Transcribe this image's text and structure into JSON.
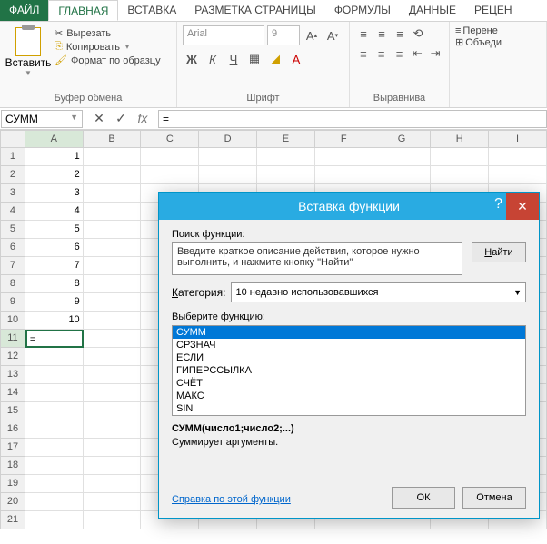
{
  "tabs": {
    "file": "ФАЙЛ",
    "home": "ГЛАВНАЯ",
    "insert": "ВСТАВКА",
    "layout": "РАЗМЕТКА СТРАНИЦЫ",
    "formulas": "ФОРМУЛЫ",
    "data": "ДАННЫЕ",
    "review": "РЕЦЕН"
  },
  "ribbon": {
    "paste": "Вставить",
    "cut": "Вырезать",
    "copy": "Копировать",
    "format_painter": "Формат по образцу",
    "clipboard_label": "Буфер обмена",
    "font_name": "Arial",
    "font_size": "9",
    "font_label": "Шрифт",
    "wrap": "Перене",
    "merge": "Объеди",
    "align_label": "Выравнива"
  },
  "formula_bar": {
    "name_box": "СУММ",
    "formula": "="
  },
  "columns": [
    "A",
    "B",
    "C",
    "D",
    "E",
    "F",
    "G",
    "H",
    "I"
  ],
  "rows": [
    {
      "n": "1",
      "a": "1"
    },
    {
      "n": "2",
      "a": "2"
    },
    {
      "n": "3",
      "a": "3"
    },
    {
      "n": "4",
      "a": "4"
    },
    {
      "n": "5",
      "a": "5"
    },
    {
      "n": "6",
      "a": "6"
    },
    {
      "n": "7",
      "a": "7"
    },
    {
      "n": "8",
      "a": "8"
    },
    {
      "n": "9",
      "a": "9"
    },
    {
      "n": "10",
      "a": "10"
    },
    {
      "n": "11",
      "a": "="
    },
    {
      "n": "12",
      "a": ""
    },
    {
      "n": "13",
      "a": ""
    },
    {
      "n": "14",
      "a": ""
    },
    {
      "n": "15",
      "a": ""
    },
    {
      "n": "16",
      "a": ""
    },
    {
      "n": "17",
      "a": ""
    },
    {
      "n": "18",
      "a": ""
    },
    {
      "n": "19",
      "a": ""
    },
    {
      "n": "20",
      "a": ""
    },
    {
      "n": "21",
      "a": ""
    }
  ],
  "dialog": {
    "title": "Вставка функции",
    "search_label": "Поиск функции:",
    "search_text": "Введите краткое описание действия, которое нужно выполнить, и нажмите кнопку \"Найти\"",
    "find_btn": "Найти",
    "category_label": "Категория:",
    "category_value": "10 недавно использовавшихся",
    "select_label": "Выберите функцию:",
    "functions": [
      "СУММ",
      "СРЗНАЧ",
      "ЕСЛИ",
      "ГИПЕРССЫЛКА",
      "СЧЁТ",
      "МАКС",
      "SIN"
    ],
    "signature": "СУММ(число1;число2;...)",
    "description": "Суммирует аргументы.",
    "help_link": "Справка по этой функции",
    "ok": "ОК",
    "cancel": "Отмена"
  }
}
